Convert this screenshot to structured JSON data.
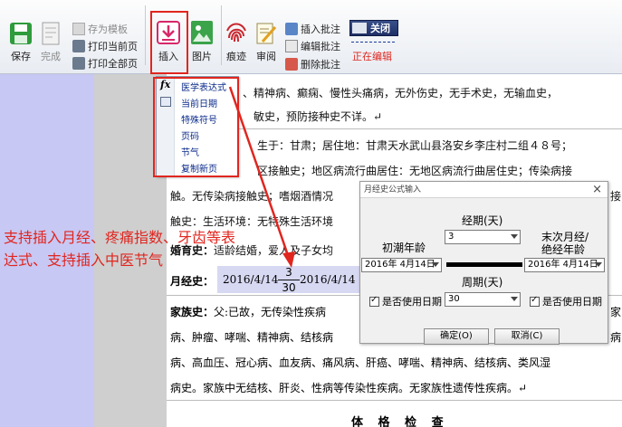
{
  "toolbar": {
    "save_label": "保存",
    "done_label": "完成",
    "save_template_label": "存为模板",
    "print_page_label": "打印当前页",
    "print_all_label": "打印全部页",
    "insert_label": "插入",
    "image_label": "图片",
    "trace_label": "痕迹",
    "review_label": "审阅",
    "insert_comment_label": "插入批注",
    "edit_comment_label": "编辑批注",
    "delete_comment_label": "删除批注",
    "toggle_label": "关闭",
    "editing_status": "正在编辑"
  },
  "insert_menu": {
    "items": [
      "医学表达式",
      "当前日期",
      "特殊符号",
      "页码",
      "节气",
      "复制新页"
    ]
  },
  "document": {
    "line1": "、精神病、癫痫、慢性头痛病，无外伤史，无手术史，无输血史，",
    "line2": "敏史，预防接种史不详。↵",
    "line3": "生于：甘肃；居住地：甘肃天水武山县洛安乡李庄村二组４８号；",
    "line4": "区接触史；地区病流行曲居住：无地区病流行曲居住史；传染病接",
    "line5_a": "触。无传染病接触史；嗜烟酒情况",
    "line5_b": "接",
    "line6_a": "触史：生活环境：无特殊生活环境",
    "marital_label": "婚育史：",
    "marital_text": "适龄结婚，爱人及子女均",
    "menstrual_label": "月经史：",
    "menstrual_start": "2016/4/14",
    "menstrual_num": "3",
    "menstrual_den": "30",
    "menstrual_end": "2016/4/14",
    "family_label": "家族史：",
    "family_text": "父:已故，无传染性疾病",
    "family_end": "家",
    "line_f2": "病、肿瘤、哮喘、精神病、结核病",
    "line_f2_end": "病",
    "line_f3": "病、高血压、冠心病、血友病、痛风病、肝癌、哮喘、精神病、结核病、类风湿",
    "line_f4": "病史。家族中无结核、肝炎、性病等传染性疾病。无家族性遗传性疾病。↵",
    "exam_title": "体 格 检 查"
  },
  "dialog": {
    "title": "月经史公式输入",
    "period_label": "经期(天)",
    "period_value": "3",
    "menarche_label": "初潮年龄",
    "last_label_1": "末次月经/",
    "last_label_2": "绝经年龄",
    "menarche_date": "2016年 4月14日",
    "last_date": "2016年 4月14日",
    "cycle_label": "周期(天)",
    "cycle_value": "30",
    "use_date_left": "是否使用日期",
    "use_date_right": "是否使用日期",
    "ok_label": "确定(O)",
    "cancel_label": "取消(C)"
  },
  "annotation": {
    "text": "支持插入月经、疼痛指数、牙齿等表达式、支持插入中医节气"
  },
  "colors": {
    "annotation_red": "#e0261f",
    "left_panel": "#c8c8f4",
    "menu_text": "#0a2a8a"
  }
}
